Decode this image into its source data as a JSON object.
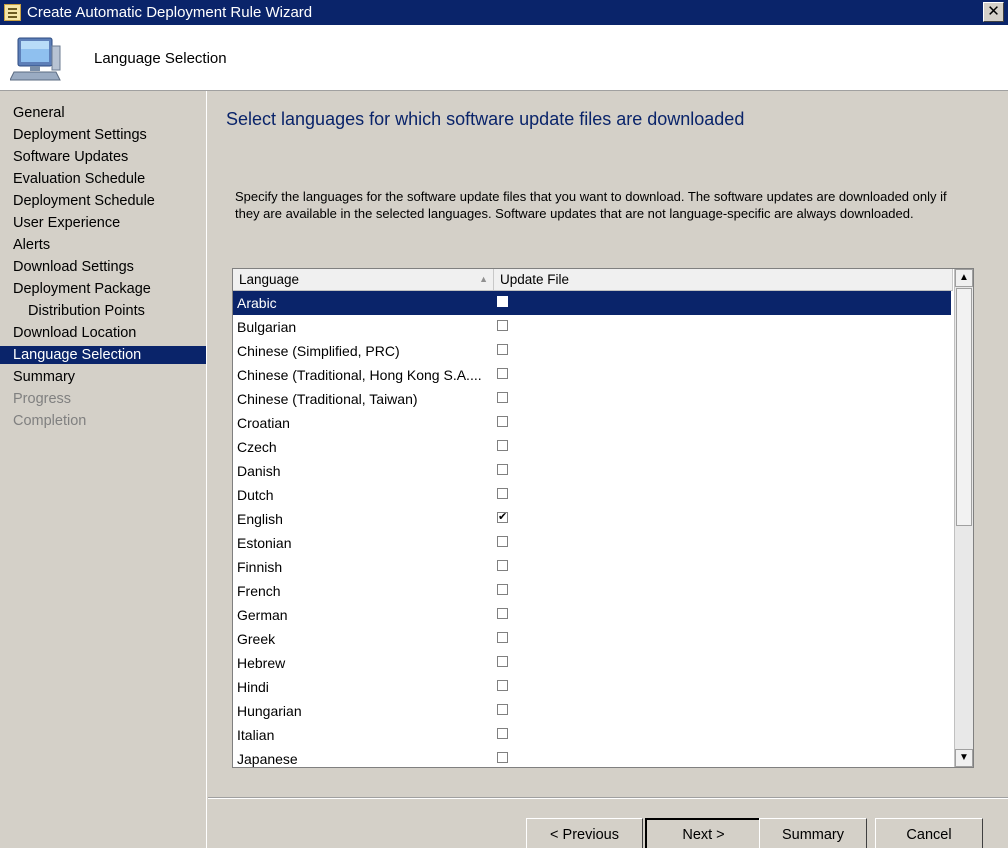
{
  "window": {
    "title": "Create Automatic Deployment Rule Wizard",
    "close_label": "✕"
  },
  "header": {
    "page_title": "Language Selection"
  },
  "nav": {
    "items": [
      {
        "label": "General",
        "state": "normal"
      },
      {
        "label": "Deployment Settings",
        "state": "normal"
      },
      {
        "label": "Software Updates",
        "state": "normal"
      },
      {
        "label": "Evaluation Schedule",
        "state": "normal"
      },
      {
        "label": "Deployment Schedule",
        "state": "normal"
      },
      {
        "label": "User Experience",
        "state": "normal"
      },
      {
        "label": "Alerts",
        "state": "normal"
      },
      {
        "label": "Download Settings",
        "state": "normal"
      },
      {
        "label": "Deployment Package",
        "state": "normal"
      },
      {
        "label": "Distribution Points",
        "state": "sub"
      },
      {
        "label": "Download Location",
        "state": "normal"
      },
      {
        "label": "Language Selection",
        "state": "active"
      },
      {
        "label": "Summary",
        "state": "normal"
      },
      {
        "label": "Progress",
        "state": "disabled"
      },
      {
        "label": "Completion",
        "state": "disabled"
      }
    ]
  },
  "main": {
    "heading": "Select languages for which software update files are downloaded",
    "description": "Specify the languages for the software update files that you want to download. The software updates are downloaded only if they are available in the selected languages. Software updates that are not language-specific are always downloaded.",
    "columns": {
      "language": "Language",
      "update_file": "Update File"
    },
    "languages": [
      {
        "name": "Arabic",
        "checked": false,
        "selected": true
      },
      {
        "name": "Bulgarian",
        "checked": false,
        "selected": false
      },
      {
        "name": "Chinese (Simplified, PRC)",
        "checked": false,
        "selected": false
      },
      {
        "name": "Chinese (Traditional, Hong Kong S.A....",
        "checked": false,
        "selected": false
      },
      {
        "name": "Chinese (Traditional, Taiwan)",
        "checked": false,
        "selected": false
      },
      {
        "name": "Croatian",
        "checked": false,
        "selected": false
      },
      {
        "name": "Czech",
        "checked": false,
        "selected": false
      },
      {
        "name": "Danish",
        "checked": false,
        "selected": false
      },
      {
        "name": "Dutch",
        "checked": false,
        "selected": false
      },
      {
        "name": "English",
        "checked": true,
        "selected": false
      },
      {
        "name": "Estonian",
        "checked": false,
        "selected": false
      },
      {
        "name": "Finnish",
        "checked": false,
        "selected": false
      },
      {
        "name": "French",
        "checked": false,
        "selected": false
      },
      {
        "name": "German",
        "checked": false,
        "selected": false
      },
      {
        "name": "Greek",
        "checked": false,
        "selected": false
      },
      {
        "name": "Hebrew",
        "checked": false,
        "selected": false
      },
      {
        "name": "Hindi",
        "checked": false,
        "selected": false
      },
      {
        "name": "Hungarian",
        "checked": false,
        "selected": false
      },
      {
        "name": "Italian",
        "checked": false,
        "selected": false
      },
      {
        "name": "Japanese",
        "checked": false,
        "selected": false
      }
    ]
  },
  "footer": {
    "previous_label": "< Previous",
    "next_label": "Next >",
    "summary_label": "Summary",
    "cancel_label": "Cancel"
  },
  "colors": {
    "title_bar": "#0a246a",
    "selection": "#0a246a",
    "heading": "#0a246a",
    "panel": "#d4d0c8"
  }
}
